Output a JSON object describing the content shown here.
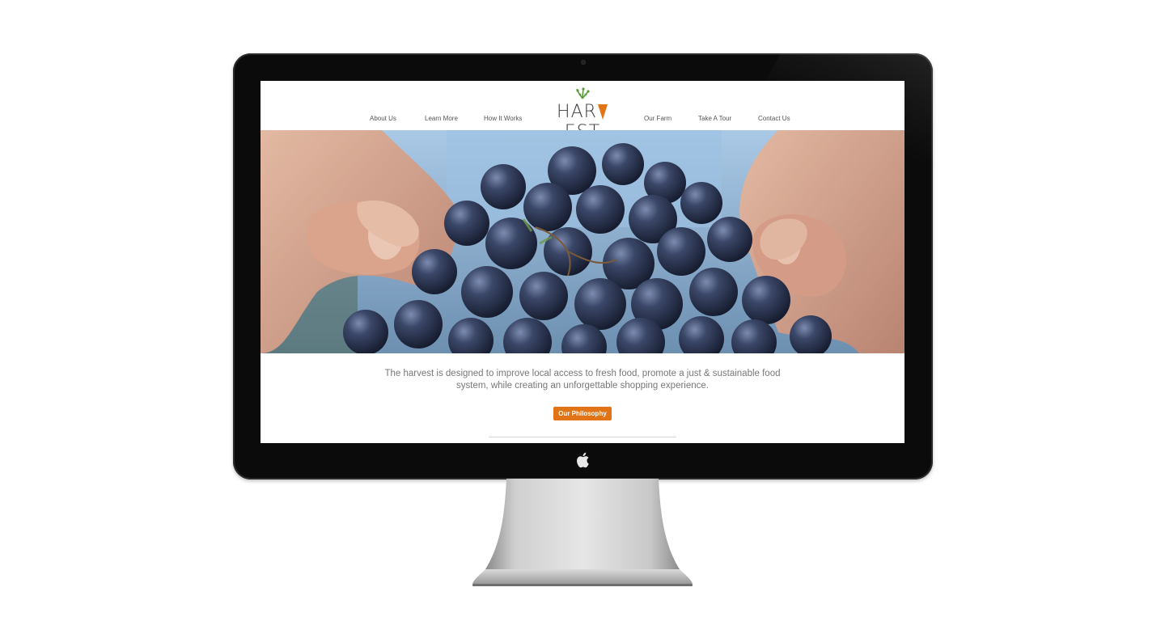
{
  "site": {
    "logo_text": "HARVEST",
    "nav_left": [
      "About Us",
      "Learn More",
      "How It Works"
    ],
    "nav_right": [
      "Our Farm",
      "Take A Tour",
      "Contact Us"
    ],
    "tagline": "The harvest is designed to improve local access to fresh food, promote a just & sustainable food system, while creating an unforgettable shopping experience.",
    "cta_label": "Our Philosophy"
  },
  "colors": {
    "accent": "#e07417",
    "logo_carrot": "#e07417",
    "logo_leaf": "#5a9a3c",
    "text": "#555555"
  },
  "hero": {
    "image": "hands-holding-grapes-photo"
  }
}
